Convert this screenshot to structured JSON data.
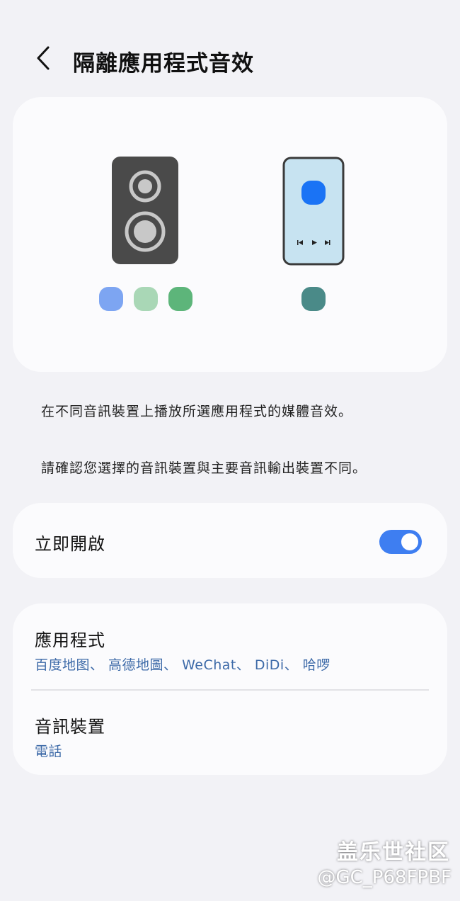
{
  "header": {
    "back_icon": "chevron-left-icon",
    "title": "隔離應用程式音效"
  },
  "illustration": {
    "colors": {
      "speaker_body": "#4a4a4a",
      "speaker_ring": "#c8c8c8",
      "phone_screen": "#c7e3f1",
      "phone_app": "#1a73f5",
      "dot_blue": "#7da5f2",
      "dot_lightgreen": "#a9d7b6",
      "dot_green": "#5db57a",
      "dot_teal": "#4a8a88"
    }
  },
  "description": {
    "line1": "在不同音訊裝置上播放所選應用程式的媒體音效。",
    "line2": "請確認您選擇的音訊裝置與主要音訊輸出裝置不同。"
  },
  "toggle": {
    "label": "立即開啟",
    "state": "on",
    "accent": "#3e7ef1"
  },
  "settings": {
    "apps": {
      "title": "應用程式",
      "value": "百度地图、 高德地圖、 WeChat、 DiDi、 哈啰"
    },
    "device": {
      "title": "音訊裝置",
      "value": "電話"
    }
  },
  "watermark": {
    "line1": "盖乐世社区",
    "line2": "@GC_P68FPBF"
  }
}
